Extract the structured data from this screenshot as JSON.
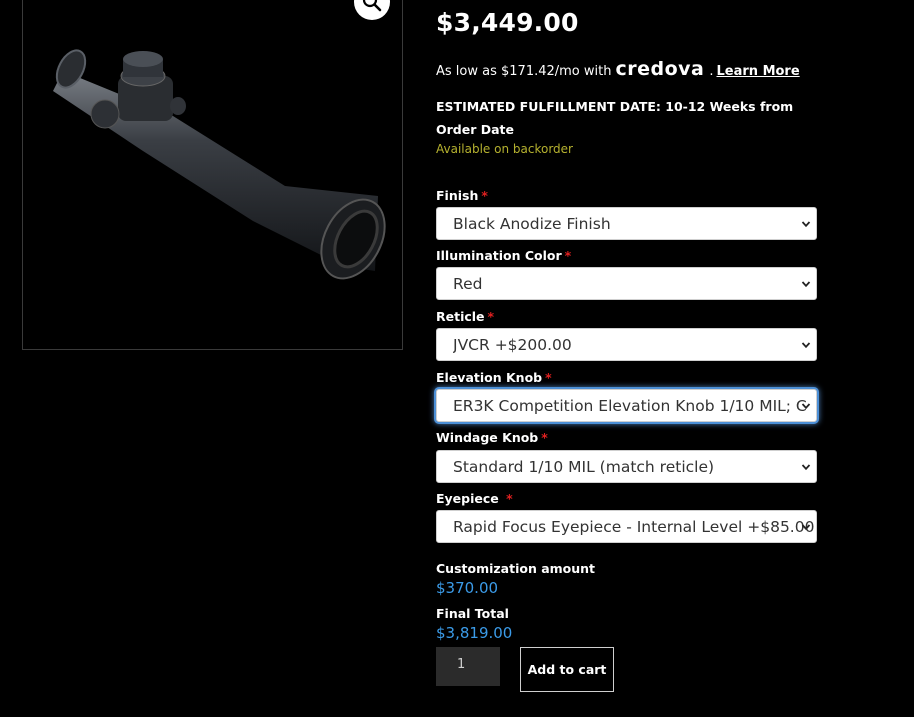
{
  "product": {
    "price": "$3,449.00",
    "zoom_icon": "magnifier-icon"
  },
  "financing": {
    "prefix": "As low as $171.42/mo with",
    "brand": "credova",
    "separator": ".",
    "learn_more": "Learn More"
  },
  "fulfillment": {
    "text": "ESTIMATED FULFILLMENT DATE: 10-12 Weeks from Order Date",
    "availability": "Available on backorder"
  },
  "options": [
    {
      "label": "Finish",
      "required": "*",
      "value": "Black Anodize Finish"
    },
    {
      "label": "Illumination Color",
      "required": "*",
      "value": "Red"
    },
    {
      "label": "Reticle",
      "required": "*",
      "value": "JVCR +$200.00"
    },
    {
      "label": "Elevation Knob",
      "required": "*",
      "value": "ER3K Competition Elevation Knob 1/10 MIL; C"
    },
    {
      "label": "Windage Knob",
      "required": "*",
      "value": "Standard 1/10 MIL (match reticle)"
    },
    {
      "label": "Eyepiece ",
      "required": "*",
      "value": "Rapid Focus Eyepiece - Internal Level +$85.00"
    }
  ],
  "totals": {
    "customization_label": "Customization amount",
    "customization_value": "$370.00",
    "final_label": "Final Total",
    "final_value": "$3,819.00"
  },
  "cart": {
    "quantity": "1",
    "add_to_cart": "Add to cart"
  },
  "colors": {
    "background": "#000000",
    "availability": "#b5b12f",
    "amount": "#3b9be8",
    "required": "#e02020",
    "focus_ring": "#4c8fd6"
  }
}
